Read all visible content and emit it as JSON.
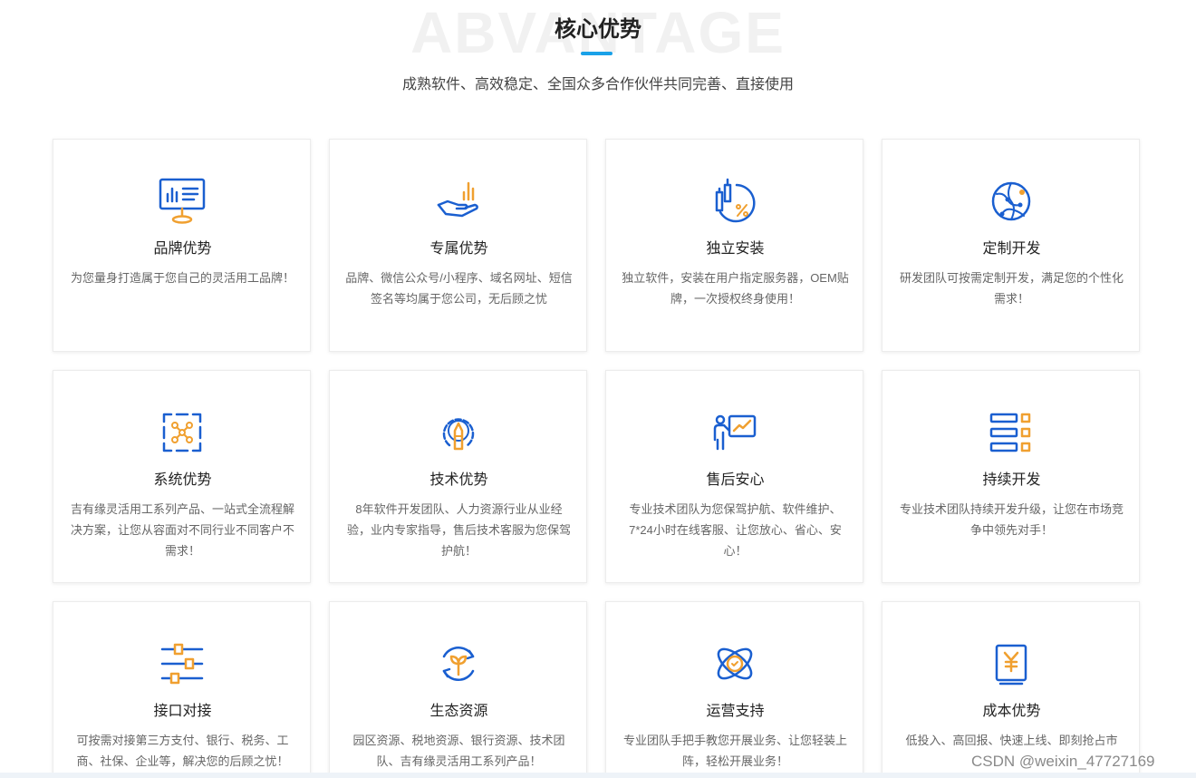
{
  "header": {
    "bg_word": "ABVANTAGE",
    "title": "核心优势",
    "subtitle": "成熟软件、高效稳定、全国众多合作伙伴共同完善、直接使用"
  },
  "colors": {
    "accent_blue": "#1a5fd0",
    "accent_orange": "#f0a030",
    "underline": "#1aa1e8"
  },
  "cards": [
    {
      "icon": "monitor-chart-icon",
      "title": "品牌优势",
      "desc": "为您量身打造属于您自己的灵活用工品牌！"
    },
    {
      "icon": "hand-growth-icon",
      "title": "专属优势",
      "desc": "品牌、微信公众号/小程序、域名网址、短信签名等均属于您公司，无后顾之忧"
    },
    {
      "icon": "finance-percent-icon",
      "title": "独立安装",
      "desc": "独立软件，安装在用户指定服务器，OEM贴牌，一次授权终身使用！"
    },
    {
      "icon": "globe-network-icon",
      "title": "定制开发",
      "desc": "研发团队可按需定制开发，满足您的个性化需求！"
    },
    {
      "icon": "system-nodes-icon",
      "title": "系统优势",
      "desc": "吉有缘灵活用工系列产品、一站式全流程解决方案，让您从容面对不同行业不同客户不需求！"
    },
    {
      "icon": "gear-pen-icon",
      "title": "技术优势",
      "desc": "8年软件开发团队、人力资源行业从业经验，业内专家指导，售后技术客服为您保驾护航！"
    },
    {
      "icon": "presenter-icon",
      "title": "售后安心",
      "desc": "专业技术团队为您保驾护航、软件维护、7*24小时在线客服、让您放心、省心、安心！"
    },
    {
      "icon": "checklist-icon",
      "title": "持续开发",
      "desc": "专业技术团队持续开发升级，让您在市场竞争中领先对手！"
    },
    {
      "icon": "sliders-icon",
      "title": "接口对接",
      "desc": "可按需对接第三方支付、银行、税务、工商、社保、企业等，解决您的后顾之忧！"
    },
    {
      "icon": "eco-sprout-icon",
      "title": "生态资源",
      "desc": "园区资源、税地资源、银行资源、技术团队、吉有缘灵活用工系列产品！"
    },
    {
      "icon": "atom-orbit-icon",
      "title": "运营支持",
      "desc": "专业团队手把手教您开展业务、让您轻装上阵，轻松开展业务！"
    },
    {
      "icon": "yen-doc-icon",
      "title": "成本优势",
      "desc": "低投入、高回报、快速上线、即刻抢占市"
    }
  ],
  "watermark": "CSDN @weixin_47727169"
}
